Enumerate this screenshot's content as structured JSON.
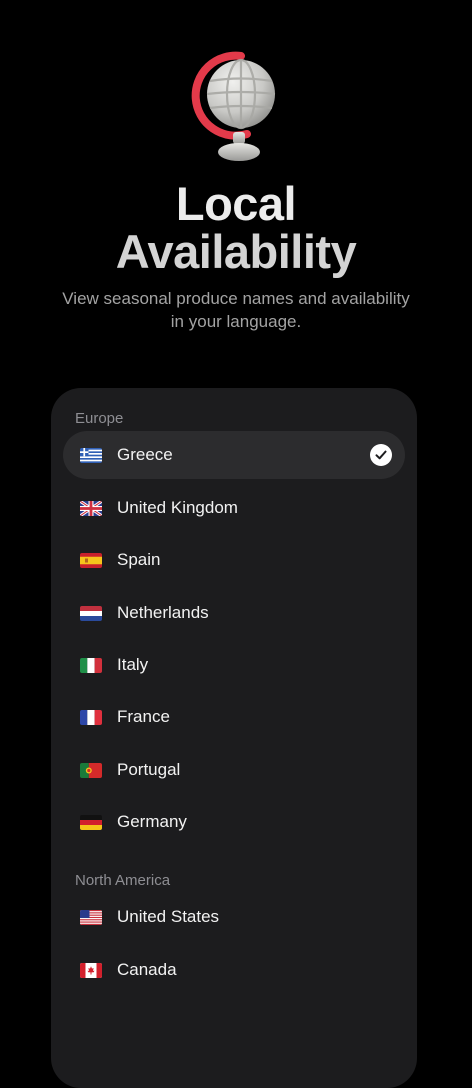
{
  "header": {
    "title_line1": "Local",
    "title_line2": "Availability",
    "subtitle": "View seasonal produce names and availability in your language."
  },
  "illustration": {
    "icon": "globe-icon"
  },
  "sections": [
    {
      "label": "Europe",
      "items": [
        {
          "label": "Greece",
          "flag": "greece-flag-icon",
          "selected": true
        },
        {
          "label": "United Kingdom",
          "flag": "uk-flag-icon",
          "selected": false
        },
        {
          "label": "Spain",
          "flag": "spain-flag-icon",
          "selected": false
        },
        {
          "label": "Netherlands",
          "flag": "netherlands-flag-icon",
          "selected": false
        },
        {
          "label": "Italy",
          "flag": "italy-flag-icon",
          "selected": false
        },
        {
          "label": "France",
          "flag": "france-flag-icon",
          "selected": false
        },
        {
          "label": "Portugal",
          "flag": "portugal-flag-icon",
          "selected": false
        },
        {
          "label": "Germany",
          "flag": "germany-flag-icon",
          "selected": false
        }
      ]
    },
    {
      "label": "North America",
      "items": [
        {
          "label": "United States",
          "flag": "usa-flag-icon",
          "selected": false
        },
        {
          "label": "Canada",
          "flag": "canada-flag-icon",
          "selected": false
        }
      ]
    }
  ],
  "colors": {
    "background": "#000000",
    "card": "#1c1c1e",
    "selected_row": "#2c2c2e",
    "subtitle": "#a3a3a3",
    "section_label": "#8e8e93",
    "globe_stand": "#e33a4a"
  }
}
